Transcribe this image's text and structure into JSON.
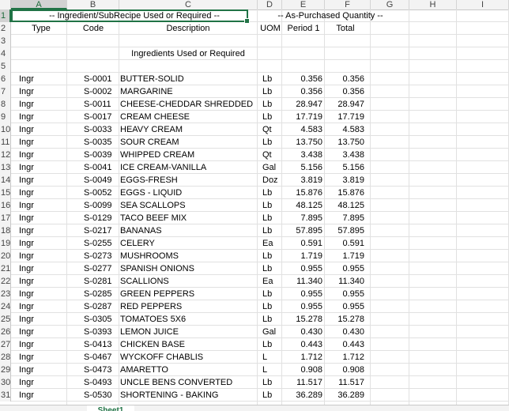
{
  "columns": [
    "A",
    "B",
    "C",
    "D",
    "E",
    "F",
    "G",
    "H",
    "I"
  ],
  "row_numbers": [
    "1",
    "2",
    "3",
    "4",
    "5",
    "6",
    "7",
    "8",
    "9",
    "10",
    "11",
    "12",
    "13",
    "14",
    "15",
    "16",
    "17",
    "18",
    "19",
    "20",
    "21",
    "22",
    "23",
    "24",
    "25",
    "26",
    "27",
    "28",
    "29",
    "30",
    "31"
  ],
  "header": {
    "group_ingredient": "-- Ingredient/SubRecipe Used or Required --",
    "group_quantity": "-- As-Purchased Quantity --",
    "type": "Type",
    "code": "Code",
    "description": "Description",
    "uom": "UOM",
    "period1": "Period 1",
    "total": "Total"
  },
  "section_title": "Ingredients Used or Required",
  "rows": [
    {
      "type": "Ingr",
      "code": "S-0001",
      "desc": "BUTTER-SOLID",
      "uom": "Lb",
      "p1": "0.356",
      "total": "0.356"
    },
    {
      "type": "Ingr",
      "code": "S-0002",
      "desc": "MARGARINE",
      "uom": "Lb",
      "p1": "0.356",
      "total": "0.356"
    },
    {
      "type": "Ingr",
      "code": "S-0011",
      "desc": "CHEESE-CHEDDAR SHREDDED",
      "uom": "Lb",
      "p1": "28.947",
      "total": "28.947"
    },
    {
      "type": "Ingr",
      "code": "S-0017",
      "desc": "CREAM CHEESE",
      "uom": "Lb",
      "p1": "17.719",
      "total": "17.719"
    },
    {
      "type": "Ingr",
      "code": "S-0033",
      "desc": "HEAVY CREAM",
      "uom": "Qt",
      "p1": "4.583",
      "total": "4.583"
    },
    {
      "type": "Ingr",
      "code": "S-0035",
      "desc": "SOUR CREAM",
      "uom": "Lb",
      "p1": "13.750",
      "total": "13.750"
    },
    {
      "type": "Ingr",
      "code": "S-0039",
      "desc": "WHIPPED CREAM",
      "uom": "Qt",
      "p1": "3.438",
      "total": "3.438"
    },
    {
      "type": "Ingr",
      "code": "S-0041",
      "desc": "ICE CREAM-VANILLA",
      "uom": "Gal",
      "p1": "5.156",
      "total": "5.156"
    },
    {
      "type": "Ingr",
      "code": "S-0049",
      "desc": "EGGS-FRESH",
      "uom": "Doz",
      "p1": "3.819",
      "total": "3.819"
    },
    {
      "type": "Ingr",
      "code": "S-0052",
      "desc": "EGGS - LIQUID",
      "uom": "Lb",
      "p1": "15.876",
      "total": "15.876"
    },
    {
      "type": "Ingr",
      "code": "S-0099",
      "desc": "SEA SCALLOPS",
      "uom": "Lb",
      "p1": "48.125",
      "total": "48.125"
    },
    {
      "type": "Ingr",
      "code": "S-0129",
      "desc": "TACO BEEF MIX",
      "uom": "Lb",
      "p1": "7.895",
      "total": "7.895"
    },
    {
      "type": "Ingr",
      "code": "S-0217",
      "desc": "BANANAS",
      "uom": "Lb",
      "p1": "57.895",
      "total": "57.895"
    },
    {
      "type": "Ingr",
      "code": "S-0255",
      "desc": "CELERY",
      "uom": "Ea",
      "p1": "0.591",
      "total": "0.591"
    },
    {
      "type": "Ingr",
      "code": "S-0273",
      "desc": "MUSHROOMS",
      "uom": "Lb",
      "p1": "1.719",
      "total": "1.719"
    },
    {
      "type": "Ingr",
      "code": "S-0277",
      "desc": "SPANISH ONIONS",
      "uom": "Lb",
      "p1": "0.955",
      "total": "0.955"
    },
    {
      "type": "Ingr",
      "code": "S-0281",
      "desc": "SCALLIONS",
      "uom": "Ea",
      "p1": "11.340",
      "total": "11.340"
    },
    {
      "type": "Ingr",
      "code": "S-0285",
      "desc": "GREEN PEPPERS",
      "uom": "Lb",
      "p1": "0.955",
      "total": "0.955"
    },
    {
      "type": "Ingr",
      "code": "S-0287",
      "desc": "RED PEPPERS",
      "uom": "Lb",
      "p1": "0.955",
      "total": "0.955"
    },
    {
      "type": "Ingr",
      "code": "S-0305",
      "desc": "TOMATOES 5X6",
      "uom": "Lb",
      "p1": "15.278",
      "total": "15.278"
    },
    {
      "type": "Ingr",
      "code": "S-0393",
      "desc": "LEMON JUICE",
      "uom": "Gal",
      "p1": "0.430",
      "total": "0.430"
    },
    {
      "type": "Ingr",
      "code": "S-0413",
      "desc": "CHICKEN BASE",
      "uom": "Lb",
      "p1": "0.443",
      "total": "0.443"
    },
    {
      "type": "Ingr",
      "code": "S-0467",
      "desc": "WYCKOFF CHABLIS",
      "uom": "L",
      "p1": "1.712",
      "total": "1.712"
    },
    {
      "type": "Ingr",
      "code": "S-0473",
      "desc": "AMARETTO",
      "uom": "L",
      "p1": "0.908",
      "total": "0.908"
    },
    {
      "type": "Ingr",
      "code": "S-0493",
      "desc": "UNCLE BENS CONVERTED",
      "uom": "Lb",
      "p1": "11.517",
      "total": "11.517"
    },
    {
      "type": "Ingr",
      "code": "S-0530",
      "desc": "SHORTENING - BAKING",
      "uom": "Lb",
      "p1": "36.289",
      "total": "36.289"
    }
  ],
  "sheet_tab": "Sheet1"
}
